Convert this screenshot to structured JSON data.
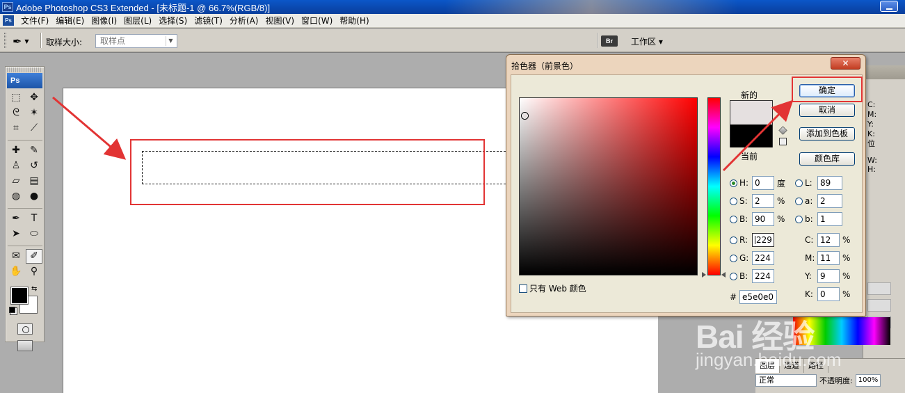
{
  "app": {
    "title": "Adobe Photoshop CS3 Extended - [未标题-1 @ 66.7%(RGB/8)]",
    "ps_badge": "Ps"
  },
  "menu": [
    "文件(F)",
    "编辑(E)",
    "图像(I)",
    "图层(L)",
    "选择(S)",
    "滤镜(T)",
    "分析(A)",
    "视图(V)",
    "窗口(W)",
    "帮助(H)"
  ],
  "options": {
    "sample_size_label": "取样大小:",
    "sample_size_value": "取样点",
    "bridge_label": "Br",
    "workspace_label": "工作区 ▾"
  },
  "toolbox": {
    "header": "Ps",
    "tools": [
      "marquee-icon",
      "move-icon",
      "lasso-icon",
      "magic-wand-icon",
      "crop-icon",
      "slice-icon",
      "healing-icon",
      "brush-icon",
      "stamp-icon",
      "history-brush-icon",
      "eraser-icon",
      "gradient-icon",
      "blur-icon",
      "dodge-icon",
      "pen-icon",
      "type-icon",
      "path-select-icon",
      "ellipse-icon",
      "notes-icon",
      "eyedropper-icon",
      "hand-icon",
      "zoom-icon"
    ],
    "active_tool": "eyedropper-icon",
    "foreground_color": "#000000",
    "background_color": "#ffffff"
  },
  "dialog": {
    "title": "拾色器（前景色）",
    "close_label": "✕",
    "new_label": "新的",
    "current_label": "当前",
    "new_color": "#e5e0e0",
    "current_color": "#000000",
    "buttons": {
      "ok": "确定",
      "cancel": "取消",
      "add_swatch": "添加到色板",
      "color_library": "颜色库"
    },
    "web_only_label": "只有 Web 颜色",
    "fields": {
      "H": {
        "label": "H:",
        "value": "0",
        "unit": "度"
      },
      "S": {
        "label": "S:",
        "value": "2",
        "unit": "%"
      },
      "B": {
        "label": "B:",
        "value": "90",
        "unit": "%"
      },
      "R": {
        "label": "R:",
        "value": "229"
      },
      "G": {
        "label": "G:",
        "value": "224"
      },
      "Bl": {
        "label": "B:",
        "value": "224"
      },
      "L": {
        "label": "L:",
        "value": "89"
      },
      "a": {
        "label": "a:",
        "value": "2"
      },
      "b": {
        "label": "b:",
        "value": "1"
      },
      "C": {
        "label": "C:",
        "value": "12",
        "unit": "%"
      },
      "M": {
        "label": "M:",
        "value": "11",
        "unit": "%"
      },
      "Y": {
        "label": "Y:",
        "value": "9",
        "unit": "%"
      },
      "K": {
        "label": "K:",
        "value": "0",
        "unit": "%"
      },
      "hex": {
        "label": "#",
        "value": "e5e0e0"
      }
    },
    "selected_mode": "H"
  },
  "right_panel": {
    "info_labels": [
      "C:",
      "M:",
      "Y:",
      "K:",
      "位"
    ],
    "info_labels2": [
      "W:",
      "H:"
    ]
  },
  "layers_panel": {
    "tabs": [
      "图层",
      "通道",
      "路径"
    ],
    "blend_mode": "正常",
    "opacity_label": "不透明度:",
    "opacity_value": "100%"
  },
  "watermark": {
    "main": "Bai 经验",
    "sub": "jingyan.baidu.com"
  },
  "colors": {
    "annotation": "#e23434",
    "title_bar": "#0a3e9c",
    "dialog_frame": "#ecd5bd"
  }
}
